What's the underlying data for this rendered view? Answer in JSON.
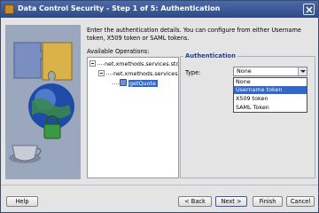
{
  "window": {
    "title": "Data Control Security - Step 1 of 5: Authentication"
  },
  "content": {
    "intro": "Enter the authentication details. You can configure from either Username token, X509 token or SAML tokens.",
    "operations_label": "Available Operations:"
  },
  "tree": {
    "nodes": [
      {
        "label": "net.xmethods.services.stockq",
        "level": 0
      },
      {
        "label": "net.xmethods.services.sto",
        "level": 1
      },
      {
        "label": "getQuote",
        "level": 2,
        "selected": true
      }
    ]
  },
  "auth": {
    "group_title": "Authentication",
    "type_label": "Type:",
    "selected": "None",
    "options": [
      "None",
      "Username token",
      "X509 token",
      "SAML Token"
    ],
    "highlighted_option": "Username token"
  },
  "buttons": {
    "help": "Help",
    "back": "< Back",
    "next": "Next >",
    "finish": "Finish",
    "cancel": "Cancel"
  },
  "colors": {
    "titlebar": "#3d5a96",
    "selection": "#3167c6",
    "group_title": "#1f3f8f"
  }
}
